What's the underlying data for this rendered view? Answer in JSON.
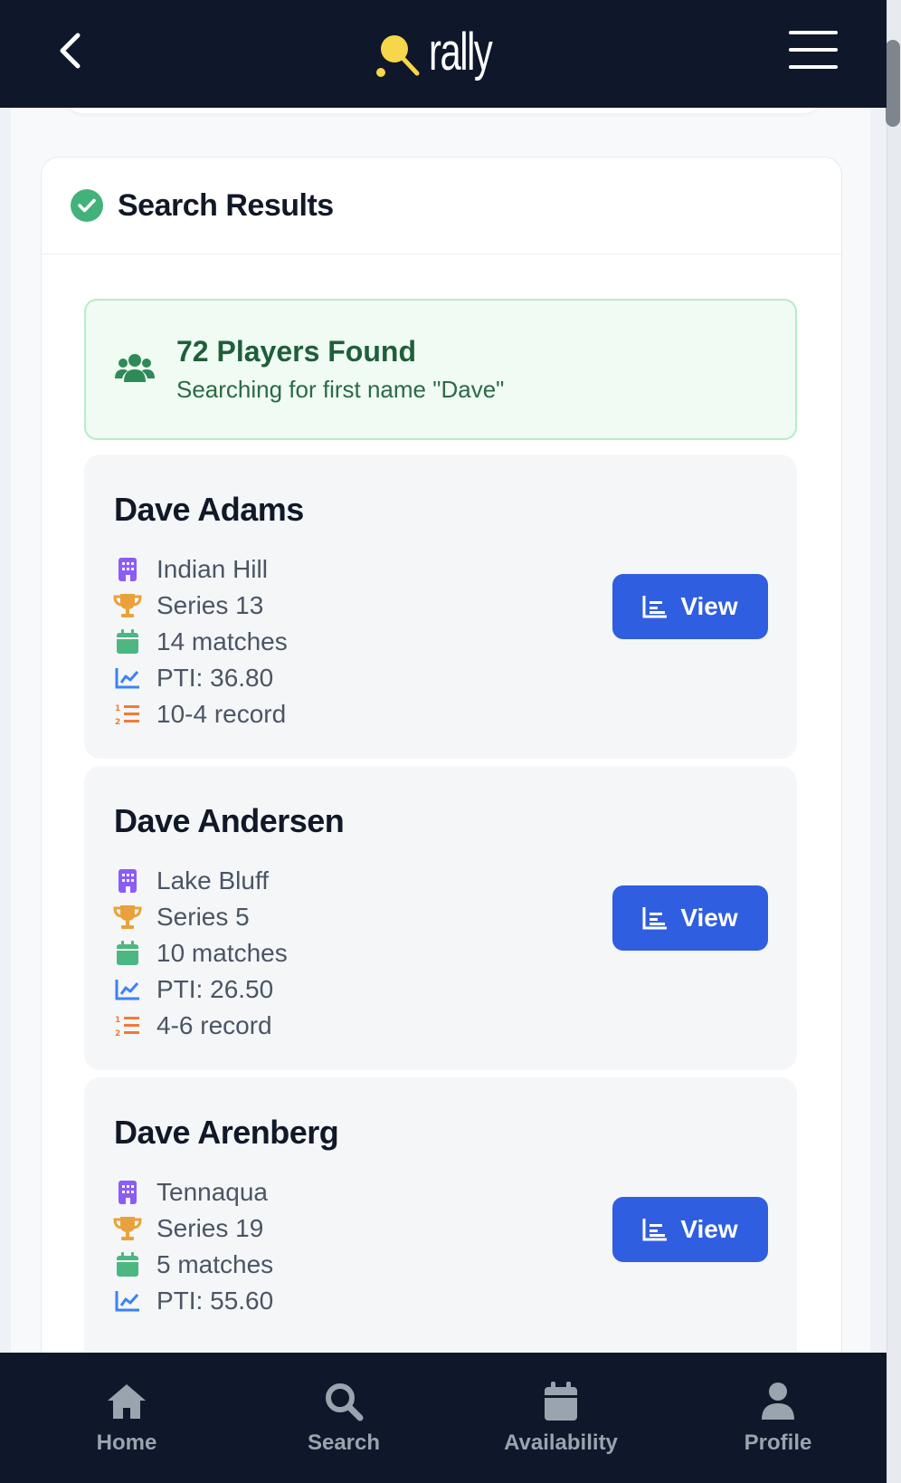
{
  "header": {
    "logo_text": "rally"
  },
  "results": {
    "title": "Search Results",
    "summary": {
      "title": "72 Players Found",
      "subtitle": "Searching for first name \"Dave\""
    },
    "players": [
      {
        "name": "Dave Adams",
        "club": "Indian Hill",
        "series": "Series 13",
        "matches": "14 matches",
        "pti": "PTI: 36.80",
        "record": "10-4 record",
        "button": "View"
      },
      {
        "name": "Dave Andersen",
        "club": "Lake Bluff",
        "series": "Series 5",
        "matches": "10 matches",
        "pti": "PTI: 26.50",
        "record": "4-6 record",
        "button": "View"
      },
      {
        "name": "Dave Arenberg",
        "club": "Tennaqua",
        "series": "Series 19",
        "matches": "5 matches",
        "pti": "PTI: 55.60",
        "record": "",
        "button": "View"
      }
    ]
  },
  "nav": {
    "home": "Home",
    "search": "Search",
    "availability": "Availability",
    "profile": "Profile"
  },
  "colors": {
    "header_bg": "#0f172a",
    "accent_blue": "#2f5ee0",
    "success_green": "#42b27a",
    "club_icon": "#8b5cf6",
    "series_icon": "#e9a23b",
    "matches_icon": "#4cb782",
    "pti_icon": "#3b82f6",
    "record_icon": "#f07a3a"
  },
  "icons": [
    "chevron-left-icon",
    "rally-logo-icon",
    "menu-icon",
    "check-circle-icon",
    "users-icon",
    "building-icon",
    "trophy-icon",
    "calendar-icon",
    "chart-line-icon",
    "list-ol-icon",
    "chart-bar-icon",
    "home-icon",
    "search-icon",
    "profile-icon"
  ]
}
